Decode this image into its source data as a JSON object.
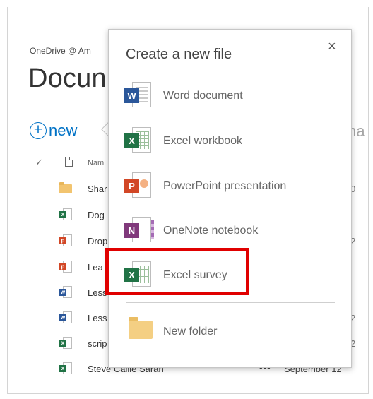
{
  "breadcrumb": "OneDrive @ Am",
  "page_title": "Docun",
  "new_button": {
    "label": "new",
    "plus": "+"
  },
  "manage_peek": "ma",
  "list": {
    "check": "✓",
    "col_name": "Nam",
    "rows": [
      {
        "icon": "folder-icon",
        "name": "Shar",
        "more": "",
        "date": "",
        "peek": "0"
      },
      {
        "icon": "excel-icon",
        "name": "Dog",
        "more": "",
        "date": "",
        "peek": ""
      },
      {
        "icon": "powerpoint-icon",
        "name": "Drop",
        "more": "",
        "date": "",
        "peek": "2"
      },
      {
        "icon": "powerpoint-icon",
        "name": "Lea",
        "more": "",
        "date": "",
        "peek": ""
      },
      {
        "icon": "word-icon",
        "name": "Less",
        "more": "",
        "date": "",
        "peek": ""
      },
      {
        "icon": "word-icon",
        "name": "Less",
        "more": "",
        "date": "",
        "peek": "2"
      },
      {
        "icon": "excel-icon",
        "name": "scrip",
        "more": "",
        "date": "",
        "peek": "2"
      },
      {
        "icon": "excel-icon",
        "name": "Steve Callie Sarah",
        "more": "•••",
        "date": "September 12",
        "peek": ""
      }
    ]
  },
  "callout": {
    "title": "Create a new file",
    "close": "×",
    "items": [
      {
        "label": "Word document",
        "badge": "W",
        "color": "#2b579a"
      },
      {
        "label": "Excel workbook",
        "badge": "X",
        "color": "#217346"
      },
      {
        "label": "PowerPoint presentation",
        "badge": "P",
        "color": "#d24726"
      },
      {
        "label": "OneNote notebook",
        "badge": "N",
        "color": "#80397b"
      },
      {
        "label": "Excel survey",
        "badge": "X",
        "color": "#217346"
      },
      {
        "label": "New folder"
      }
    ]
  },
  "colors": {
    "accent": "#0072c6",
    "highlight": "#e00000"
  }
}
